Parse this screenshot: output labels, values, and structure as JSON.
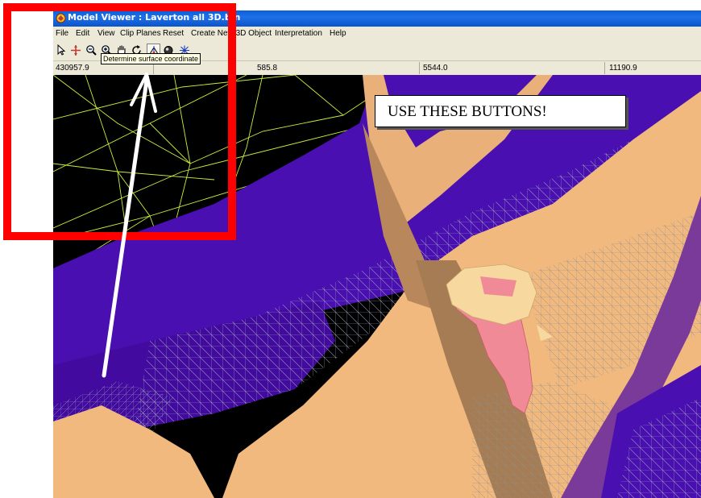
{
  "window": {
    "title": "Model Viewer : Laverton all 3D.bin",
    "colors": {
      "titlebar": "#0a5fd8",
      "chrome": "#ece9d8"
    }
  },
  "menu": {
    "items": [
      "File",
      "Edit",
      "View",
      "Clip Planes",
      "Reset",
      "Create New 3D Object",
      "Interpretation",
      "Help"
    ]
  },
  "toolbar": {
    "buttons": [
      {
        "icon": "pointer-arrow-icon"
      },
      {
        "icon": "move-cross-icon"
      },
      {
        "icon": "zoom-out-icon"
      },
      {
        "icon": "zoom-in-icon"
      },
      {
        "icon": "pan-hand-icon"
      },
      {
        "icon": "rotate-icon"
      },
      {
        "icon": "surface-coordinate-icon",
        "pressed": true
      },
      {
        "icon": "sphere-icon"
      },
      {
        "icon": "axes-icon"
      }
    ],
    "tooltip": "Determine surface coordinate"
  },
  "coords": {
    "x": "430957.9",
    "y": "585.8",
    "z": "5544.0",
    "w": "11190.9"
  },
  "annotation": {
    "callout": "USE THESE BUTTONS!",
    "colors": {
      "box": "#ff0000",
      "arrow": "#ffffff"
    }
  },
  "scene": {
    "colors": {
      "background": "#000000",
      "wireframe": "#c7f23c",
      "purple": "#4a0fb0",
      "tan": "#f1b97e",
      "mesh": "#9aa0b8",
      "orebody_pink": "#f08a96",
      "orebody_cream": "#f7d9a0",
      "violet_band": "#7a3a9a"
    }
  }
}
